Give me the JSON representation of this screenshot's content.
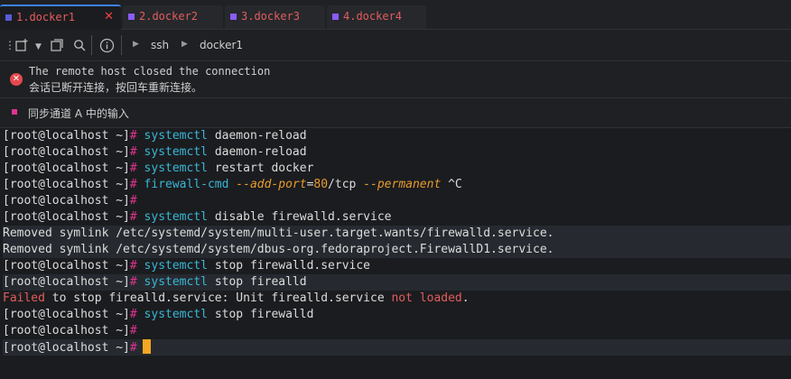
{
  "tabs": [
    {
      "label": "1.docker1",
      "active": true
    },
    {
      "label": "2.docker2",
      "active": false
    },
    {
      "label": "3.docker3",
      "active": false
    },
    {
      "label": "4.docker4",
      "active": false
    }
  ],
  "toolbar": {
    "icons": [
      "grip-icon",
      "new-tab-icon",
      "dropdown-icon",
      "duplicate-icon",
      "search-icon",
      "info-icon"
    ],
    "breadcrumb": [
      "ssh",
      "docker1"
    ]
  },
  "notice": {
    "line1": "The remote host closed the connection",
    "line2": "会话已断开连接，按回车重新连接。"
  },
  "sync": {
    "label": "同步通道 A 中的输入"
  },
  "terminal": {
    "prompt": "[root@localhost ~]",
    "hash": "#",
    "lines": [
      {
        "type": "cmd",
        "cmd": "systemctl",
        "rest": " daemon-reload"
      },
      {
        "type": "cmd",
        "cmd": "systemctl",
        "rest": " daemon-reload"
      },
      {
        "type": "cmd",
        "cmd": "systemctl",
        "rest": " restart docker"
      },
      {
        "type": "fw",
        "cmd": "firewall-cmd",
        "opt1": "--add-port",
        "eq": "=",
        "num": "80",
        "slash": "/tcp ",
        "opt2": "--permanent",
        "tail": " ^C"
      },
      {
        "type": "empty"
      },
      {
        "type": "cmd",
        "cmd": "systemctl",
        "rest": " disable firewalld.service"
      },
      {
        "type": "out",
        "text": "Removed symlink /etc/systemd/system/multi-user.target.wants/firewalld.service."
      },
      {
        "type": "out",
        "text": "Removed symlink /etc/systemd/system/dbus-org.fedoraproject.FirewallD1.service."
      },
      {
        "type": "cmd",
        "cmd": "systemctl",
        "rest": " stop firewalld.service"
      },
      {
        "type": "cmd",
        "cmd": "systemctl",
        "rest": " stop firealld"
      },
      {
        "type": "err",
        "a": "Failed",
        "b": " to stop firealld.service: Unit firealld.service ",
        "c": "not loaded",
        "d": "."
      },
      {
        "type": "cmd",
        "cmd": "systemctl",
        "rest": " stop firewalld"
      },
      {
        "type": "empty"
      },
      {
        "type": "cursor"
      }
    ]
  }
}
